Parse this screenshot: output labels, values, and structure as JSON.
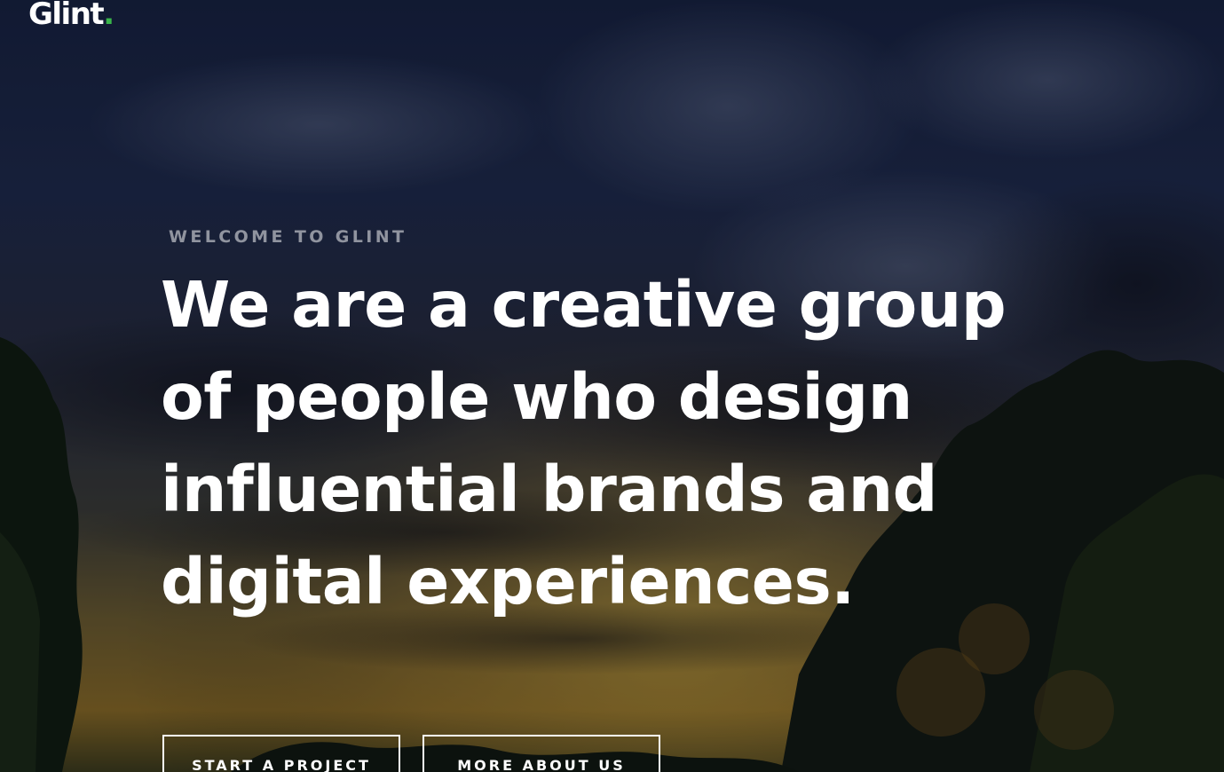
{
  "brand": {
    "logo_text": "Glint",
    "logo_dot": ".",
    "accent_color": "#39b54a"
  },
  "hero": {
    "eyebrow": "WELCOME TO GLINT",
    "headline_lines": [
      "We are a creative group",
      "of people who design",
      "influential brands and",
      "digital experiences."
    ],
    "buttons": {
      "primary": "START A PROJECT",
      "secondary": "MORE ABOUT US"
    },
    "background_image": "sunset sky with clouds and silhouetted trees"
  }
}
